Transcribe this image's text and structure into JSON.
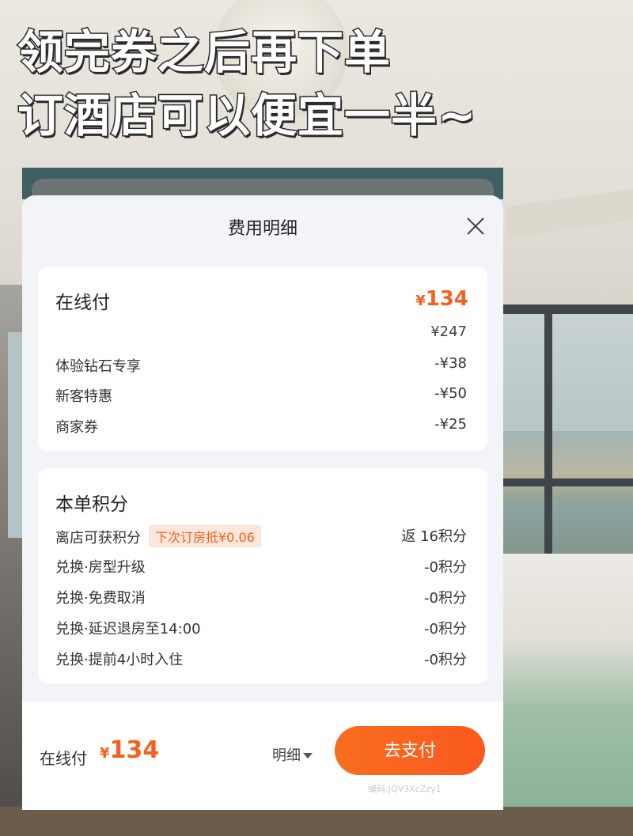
{
  "headline": {
    "line1": "领完券之后再下单",
    "line2": "订酒店可以便宜一半~"
  },
  "sheet": {
    "title": "费用明细"
  },
  "online_pay": {
    "title": "在线付",
    "currency": "¥",
    "total": "134",
    "base_price": "¥247",
    "items": [
      {
        "label": "体验钻石专享",
        "value": "-¥38"
      },
      {
        "label": "新客特惠",
        "value": "-¥50"
      },
      {
        "label": "商家券",
        "value": "-¥25"
      }
    ]
  },
  "points": {
    "title": "本单积分",
    "earn": {
      "label": "离店可获积分",
      "tag": "下次订房抵¥0.06",
      "value": "返 16积分"
    },
    "items": [
      {
        "label": "兑换·房型升级",
        "value": "-0积分"
      },
      {
        "label": "兑换·免费取消",
        "value": "-0积分"
      },
      {
        "label": "兑换·延迟退房至14:00",
        "value": "-0积分"
      },
      {
        "label": "兑换·提前4小时入住",
        "value": "-0积分"
      }
    ]
  },
  "bottom_bar": {
    "label": "在线付",
    "currency": "¥",
    "total": "134",
    "detail_label": "明细",
    "pay_label": "去支付",
    "code": "编码:JQV3XcZzy1"
  },
  "colors": {
    "accent": "#f0621d",
    "pay_button": "#fb5a1e",
    "tag_bg": "#fde6dc"
  }
}
